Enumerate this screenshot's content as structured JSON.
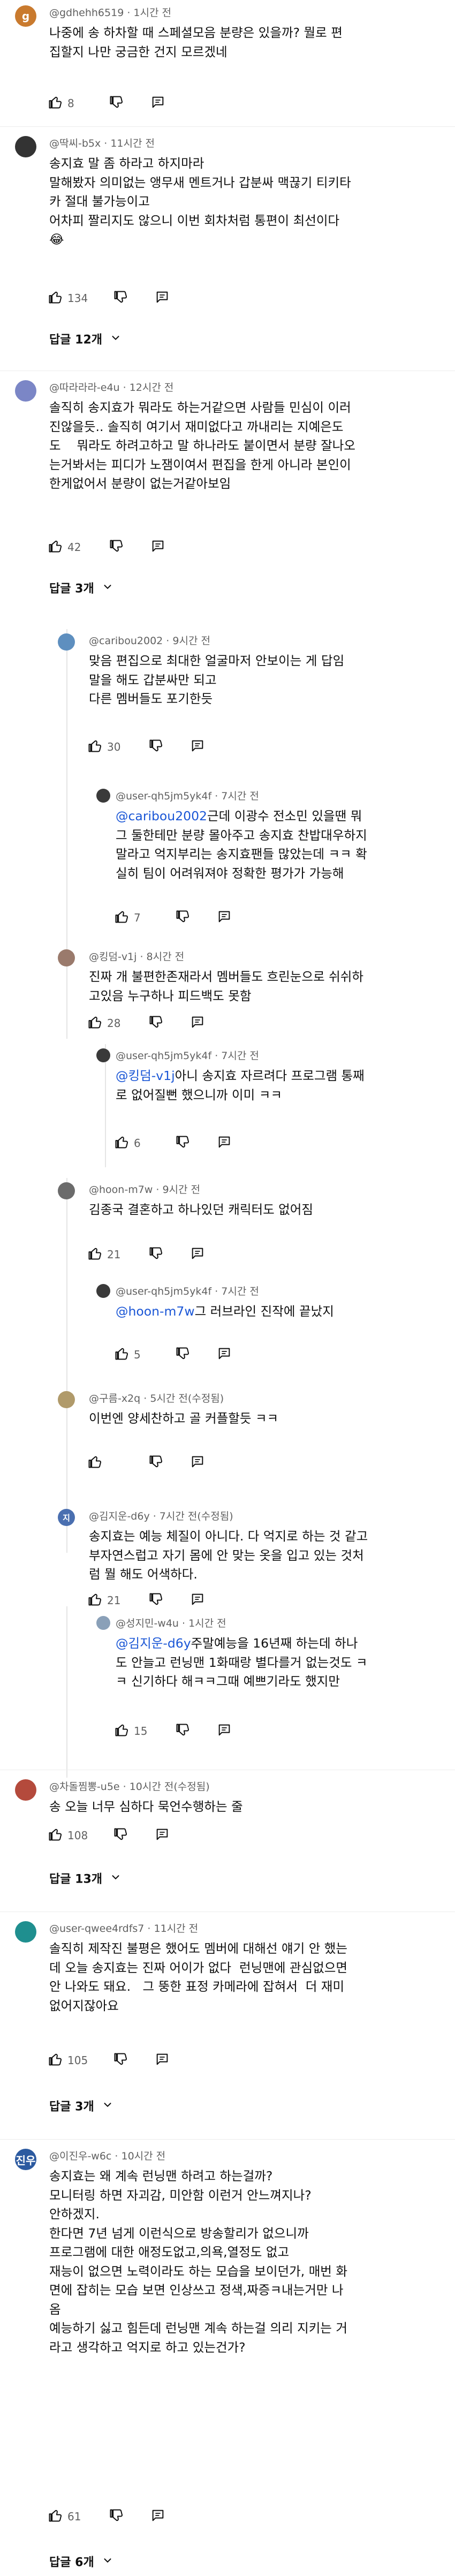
{
  "colors": {
    "mention": "#1a56d6",
    "meta": "#606060",
    "text": "#0f0f0f"
  },
  "icons": {
    "like": "thumbs-up-icon",
    "dislike": "thumbs-down-icon",
    "reply": "reply-bubble-icon"
  },
  "comments": [
    {
      "avatar_letter": "g",
      "header": "@gdhehh6519 · 1시간 전",
      "body": [
        "나중에 송 하차할 때 스페셜모음 분량은 있을까? 뭘로 편",
        "집할지 나만 궁금한 건지 모르겠네"
      ],
      "likes": "8"
    },
    {
      "avatar_letter": "",
      "header": "@딱씨-b5x · 11시간 전",
      "body": [
        "송지효 말 좀 하라고 하지마라",
        "말해봤자 의미없는 앵무새 멘트거나 갑분싸 맥끊기 티키타",
        "카 절대 불가능이고",
        "어차피 짤리지도 않으니 이번 회차처럼 통편이 최선이다",
        "😂"
      ],
      "likes": "134",
      "replies_label": "답글 12개"
    },
    {
      "avatar_letter": "",
      "header": "@따라라라-e4u · 12시간 전",
      "body": [
        "솔직히 송지효가 뭐라도 하는거같으면 사람들 민심이 이러",
        "진않을듯.. 솔직히 여기서 재미없다고 까내리는 지예은도",
        "도    뭐라도 하려고하고 말 하나라도 붙이면서 분량 잘나오",
        "는거봐서는 피디가 노잼이여서 편집을 한게 아니라 본인이",
        "한게없어서 분량이 없는거같아보임"
      ],
      "likes": "42",
      "replies_label": "답글 3개"
    },
    {
      "avatar_letter": "",
      "header": "@caribou2002 · 9시간 전",
      "body": [
        "맞음 편집으로 최대한 얼굴마저 안보이는 게 답임",
        "말을 해도 갑분싸만 되고",
        "다른 멤버들도 포기한듯"
      ],
      "likes": "30"
    },
    {
      "avatar_letter": "",
      "header": "@user-qh5jm5yk4f · 7시간 전",
      "mention": "@caribou2002",
      "body": [
        "근데 이광수 전소민 있을땐 뭐",
        "그 둘한테만 분량 몰아주고 송지효 찬밥대우하지",
        "말라고 억지부리는 송지효팬들 많았는데 ㅋㅋ 확",
        "실히 팀이 어려워져야 정확한 평가가 가능해"
      ],
      "likes": "7"
    },
    {
      "avatar_letter": "",
      "header": "@킹덤-v1j · 8시간 전",
      "body": [
        "진짜 개 불편한존재라서 멤버들도 흐린눈으로 쉬쉬하",
        "고있음 누구하나 피드백도 못함"
      ],
      "likes": "28"
    },
    {
      "avatar_letter": "",
      "header": "@user-qh5jm5yk4f · 7시간 전",
      "mention": "@킹덤-v1j",
      "body": [
        "아니 송지효 자르려다 프로그램 통째",
        "로 없어질뻔 했으니까 이미 ㅋㅋ"
      ],
      "likes": "6"
    },
    {
      "avatar_letter": "",
      "header": "@hoon-m7w · 9시간 전",
      "body": [
        "김종국 결혼하고 하나있던 캐릭터도 없어짐"
      ],
      "likes": "21"
    },
    {
      "avatar_letter": "",
      "header": "@user-qh5jm5yk4f · 7시간 전",
      "mention": "@hoon-m7w",
      "body": [
        "그 러브라인 진작에 끝났지"
      ],
      "likes": "5"
    },
    {
      "avatar_letter": "",
      "header": "@구름-x2q · 5시간 전(수정됨)",
      "body": [
        "이번엔 양세찬하고 골 커플할듯 ㅋㅋ"
      ],
      "likes": ""
    },
    {
      "avatar_letter": "지",
      "header": "@김지운-d6y · 7시간 전(수정됨)",
      "body": [
        "송지효는 예능 체질이 아니다. 다 억지로 하는 것 같고",
        "부자연스럽고 자기 몸에 안 맞는 옷을 입고 있는 것처",
        "럼 뭘 해도 어색하다."
      ],
      "likes": "21"
    },
    {
      "avatar_letter": "",
      "header": "@성지민-w4u · 1시간 전",
      "mention": "@김지운-d6y",
      "body": [
        "주말예능을 16년째 하는데 하나",
        "도 안늘고 런닝맨 1화때랑 별다를거 없는것도 ㅋ",
        "ㅋ 신기하다 해ㅋㅋ그때 예쁘기라도 했지만"
      ],
      "likes": "15"
    },
    {
      "avatar_letter": "",
      "header": "@차돌찜뽕-u5e · 10시간 전(수정됨)",
      "body": [
        "송 오늘 너무 심하다 묵언수행하는 줄"
      ],
      "likes": "108",
      "replies_label": "답글 13개"
    },
    {
      "avatar_letter": "",
      "header": "@user-qwee4rdfs7 · 11시간 전",
      "body": [
        "솔직히 제작진 불평은 했어도 멤버에 대해선 얘기 안 했는",
        "데 오늘 송지효는 진짜 어이가 없다  런닝맨에 관심없으면",
        "안 나와도 돼요.   그 뚱한 표정 카메라에 잡혀서  더 재미",
        "없어지잖아요"
      ],
      "likes": "105",
      "replies_label": "답글 3개"
    },
    {
      "avatar_letter": "진우",
      "header": "@이진우-w6c · 10시간 전",
      "body": [
        "송지효는 왜 계속 런닝맨 하려고 하는걸까?",
        "모니터링 하면 자괴감, 미안함 이런거 안느껴지나?",
        "안하겠지.",
        "한다면 7년 넘게 이런식으로 방송할리가 없으니까",
        "프로그램에 대한 애정도없고,의욕,열정도 없고",
        "재능이 없으면 노력이라도 하는 모습을 보이던가, 매번 화",
        "면에 잡히는 모습 보면 인상쓰고 정색,짜증ㅋ내는거만 나",
        "옴",
        "예능하기 싫고 힘든데 런닝맨 계속 하는걸 의리 지키는 거",
        "라고 생각하고 억지로 하고 있는건가?"
      ],
      "likes": "61",
      "replies_label": "답글 6개"
    }
  ]
}
